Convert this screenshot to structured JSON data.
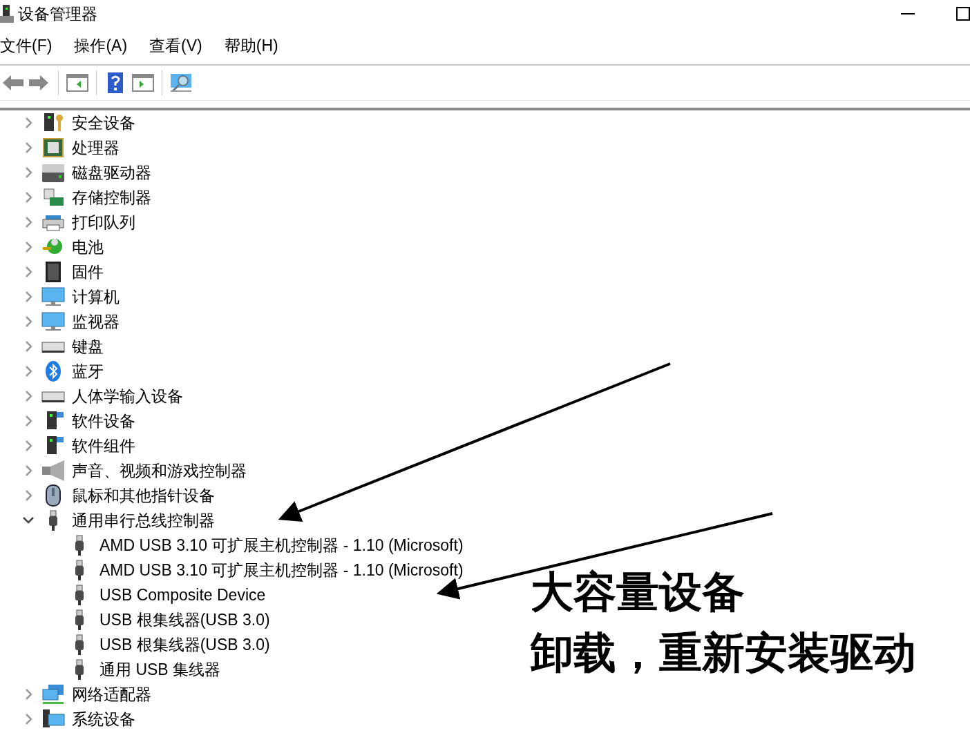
{
  "window": {
    "title": "设备管理器"
  },
  "menu": [
    "文件(F)",
    "操作(A)",
    "查看(V)",
    "帮助(H)"
  ],
  "tree": [
    {
      "label": "安全设备",
      "expanded": false
    },
    {
      "label": "处理器",
      "expanded": false
    },
    {
      "label": "磁盘驱动器",
      "expanded": false
    },
    {
      "label": "存储控制器",
      "expanded": false
    },
    {
      "label": "打印队列",
      "expanded": false
    },
    {
      "label": "电池",
      "expanded": false
    },
    {
      "label": "固件",
      "expanded": false
    },
    {
      "label": "计算机",
      "expanded": false
    },
    {
      "label": "监视器",
      "expanded": false
    },
    {
      "label": "键盘",
      "expanded": false
    },
    {
      "label": "蓝牙",
      "expanded": false
    },
    {
      "label": "人体学输入设备",
      "expanded": false
    },
    {
      "label": "软件设备",
      "expanded": false
    },
    {
      "label": "软件组件",
      "expanded": false
    },
    {
      "label": "声音、视频和游戏控制器",
      "expanded": false
    },
    {
      "label": "鼠标和其他指针设备",
      "expanded": false
    },
    {
      "label": "通用串行总线控制器",
      "expanded": true,
      "children": [
        {
          "label": "AMD USB 3.10 可扩展主机控制器 - 1.10 (Microsoft)"
        },
        {
          "label": "AMD USB 3.10 可扩展主机控制器 - 1.10 (Microsoft)"
        },
        {
          "label": "USB Composite Device"
        },
        {
          "label": "USB 根集线器(USB 3.0)"
        },
        {
          "label": "USB 根集线器(USB 3.0)"
        },
        {
          "label": "通用 USB 集线器"
        }
      ]
    },
    {
      "label": "网络适配器",
      "expanded": false
    },
    {
      "label": "系统设备",
      "expanded": false
    }
  ],
  "annotation": {
    "lines": [
      "大容量设备",
      "卸载，重新安装驱动"
    ]
  }
}
